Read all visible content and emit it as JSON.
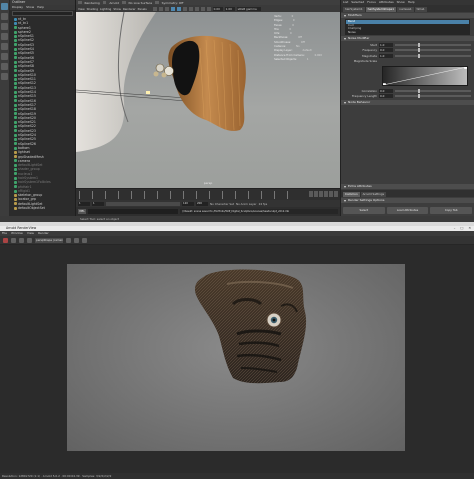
{
  "outliner": {
    "title": "Outliner",
    "menu": [
      "Display",
      "Show",
      "Help"
    ],
    "items": [
      {
        "label": "nt_tn",
        "kind": "joint"
      },
      {
        "label": "nt_tn1",
        "kind": "joint"
      },
      {
        "label": "sphere1",
        "kind": "mesh"
      },
      {
        "label": "sphere2",
        "kind": "mesh"
      },
      {
        "label": "nSplineS1",
        "kind": "mesh"
      },
      {
        "label": "nSplineS2",
        "kind": "mesh"
      },
      {
        "label": "nSplineS3",
        "kind": "mesh"
      },
      {
        "label": "nSplineS4",
        "kind": "mesh"
      },
      {
        "label": "nSplineS5",
        "kind": "mesh"
      },
      {
        "label": "nSplineS6",
        "kind": "mesh"
      },
      {
        "label": "nSplineS7",
        "kind": "mesh"
      },
      {
        "label": "nSplineS8",
        "kind": "mesh"
      },
      {
        "label": "nSplineS9",
        "kind": "mesh"
      },
      {
        "label": "nSplineS10",
        "kind": "mesh"
      },
      {
        "label": "nSplineS11",
        "kind": "mesh"
      },
      {
        "label": "nSplineS12",
        "kind": "mesh"
      },
      {
        "label": "nSplineS13",
        "kind": "mesh"
      },
      {
        "label": "nSplineS14",
        "kind": "mesh"
      },
      {
        "label": "nSplineS15",
        "kind": "mesh"
      },
      {
        "label": "nSplineS16",
        "kind": "mesh"
      },
      {
        "label": "nSplineS17",
        "kind": "mesh"
      },
      {
        "label": "nSplineS18",
        "kind": "mesh"
      },
      {
        "label": "nSplineS19",
        "kind": "mesh"
      },
      {
        "label": "nSplineS20",
        "kind": "mesh"
      },
      {
        "label": "nSplineS21",
        "kind": "mesh"
      },
      {
        "label": "nSplineS22",
        "kind": "mesh"
      },
      {
        "label": "nSplineS23",
        "kind": "mesh"
      },
      {
        "label": "nSplineS24",
        "kind": "mesh"
      },
      {
        "label": "nSplineS25",
        "kind": "mesh"
      },
      {
        "label": "nSplineS26",
        "kind": "mesh"
      },
      {
        "label": "bottom",
        "kind": "mesh"
      },
      {
        "label": "lightset",
        "kind": "grp"
      },
      {
        "label": "grpShadedMesh",
        "kind": "grp"
      },
      {
        "label": "camera",
        "kind": "mesh"
      },
      {
        "label": "defaultLightSet",
        "kind": "dim"
      },
      {
        "label": "shader_group",
        "kind": "dim"
      },
      {
        "label": "nucleus1",
        "kind": "dim"
      },
      {
        "label": "hairSystem1",
        "kind": "dim"
      },
      {
        "label": "hairSystem1Follicles",
        "kind": "dim"
      },
      {
        "label": "pfxHair1",
        "kind": "dim"
      },
      {
        "label": "nRigid1",
        "kind": "dim"
      },
      {
        "label": "skeleton_group",
        "kind": "grp"
      },
      {
        "label": "locator_grp",
        "kind": "grp"
      },
      {
        "label": "defaultLightSet",
        "kind": "grp"
      },
      {
        "label": "defaultObjectSet",
        "kind": "grp"
      }
    ]
  },
  "statusline": [
    "Rendering",
    "Arnold",
    "No Live Surface",
    "Symmetry: Off"
  ],
  "panel": {
    "menu": [
      "View",
      "Shading",
      "Lighting",
      "Show",
      "Renderer",
      "Panels"
    ],
    "gamma": "0.00",
    "exposure": "1.00",
    "colorspace": "sRGB gamma"
  },
  "viewport": {
    "camera_label": "persp",
    "hud": [
      {
        "k": "Verts:",
        "v": "0"
      },
      {
        "k": "Edges:",
        "v": "0"
      },
      {
        "k": "Faces:",
        "v": "0"
      },
      {
        "k": "Tris:",
        "v": "0"
      },
      {
        "k": "UVs:",
        "v": "0"
      },
      {
        "k": "Backfaces:",
        "v": "Off"
      },
      {
        "k": "Smoothness:",
        "v": "Off"
      },
      {
        "k": "Instance:",
        "v": "No"
      },
      {
        "k": "Display Layer:",
        "v": "default"
      },
      {
        "k": "Distance From Camera:",
        "v": "0.000"
      },
      {
        "k": "Selected Objects:",
        "v": "1"
      }
    ]
  },
  "rangeslider": {
    "start": "1",
    "end": "120",
    "start2": "1",
    "end2": "200",
    "char_set": "No Character Set",
    "anim_layer": "No Anim Layer",
    "fps": "24 fps"
  },
  "cmdline": {
    "lang": "MEL",
    "output": "// Result: scene saved to /Portfolio/WIP_Digital_Sculpture/scenes/headsculpt_v012.mb"
  },
  "helpline": "Select Tool: select an object",
  "attr_editor": {
    "menu": [
      "List",
      "Selected",
      "Focus",
      "Attributes",
      "Show",
      "Help"
    ],
    "tabs": [
      "hairSystem1",
      "hairSystemShape1",
      "nucleus1",
      "time1"
    ],
    "active_tab": 1,
    "section": "Modifiers",
    "modifiers": [
      "Bend",
      "Curl",
      "Clumping",
      "Noise"
    ],
    "selected_modifier": 0,
    "noise_section": "Noise Modifier",
    "fields": [
      {
        "label": "Start",
        "value": "1.0"
      },
      {
        "label": "Frequency",
        "value": "0.0"
      },
      {
        "label": "Magnitude",
        "value": "1.0"
      }
    ],
    "ramp_label": "Magnitude Scale",
    "fields2": [
      {
        "label": "Correlation",
        "value": "0.0"
      },
      {
        "label": "Frequency Length",
        "value": "0.0"
      }
    ],
    "node_behavior": "Node Behavior",
    "extra_attrs": "Extra Attributes",
    "buttons": [
      "Select",
      "Load Attributes",
      "Copy Tab"
    ],
    "render_settings_header": "Arnold Settings",
    "render_settings_tab": "Common",
    "render_settings_row": "Render Settings Options"
  },
  "render_view": {
    "title": "Arnold RenderView",
    "window_controls": [
      "–",
      "□",
      "✕"
    ],
    "menu": [
      "File",
      "Window",
      "View",
      "Render"
    ],
    "camera_dropdown": "perspShape (camera)",
    "status": "Resolution: 1280x720 (1:1) · Arnold 5.0.2 · 00:00:04.39 · Samples: 3/2/2/2/2/2"
  }
}
